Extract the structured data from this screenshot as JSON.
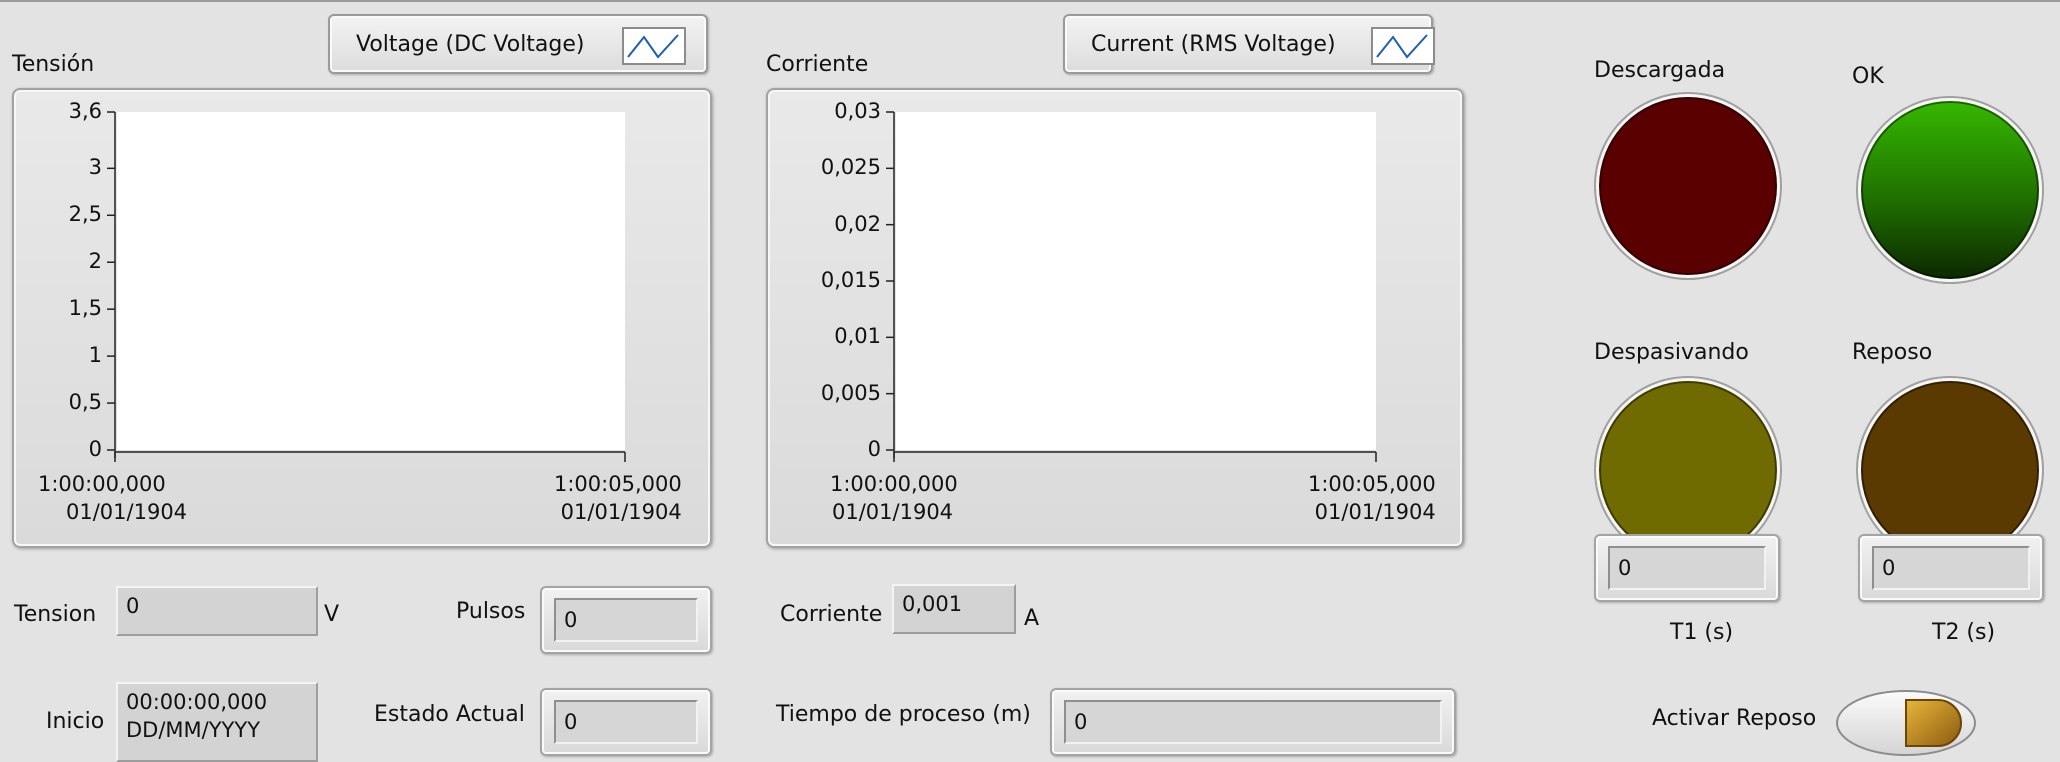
{
  "voltage_graph": {
    "title": "Tensión",
    "legend_label": "Voltage (DC Voltage)",
    "y_ticks": [
      "3,6",
      "3",
      "2,5",
      "2",
      "1,5",
      "1",
      "0,5",
      "0"
    ],
    "x_ticks": [
      {
        "time": "1:00:00,000",
        "date": "01/01/1904"
      },
      {
        "time": "1:00:05,000",
        "date": "01/01/1904"
      }
    ]
  },
  "current_graph": {
    "title": "Corriente",
    "legend_label": "Current (RMS Voltage)",
    "y_ticks": [
      "0,03",
      "0,025",
      "0,02",
      "0,015",
      "0,01",
      "0,005",
      "0"
    ],
    "x_ticks": [
      {
        "time": "1:00:00,000",
        "date": "01/01/1904"
      },
      {
        "time": "1:00:05,000",
        "date": "01/01/1904"
      }
    ]
  },
  "chart_data": [
    {
      "type": "line",
      "title": "Tensión",
      "series": [
        {
          "name": "Voltage (DC Voltage)",
          "values": []
        }
      ],
      "ylim": [
        0,
        3.6
      ],
      "x": [
        "1:00:00,000 01/01/1904",
        "1:00:05,000 01/01/1904"
      ]
    },
    {
      "type": "line",
      "title": "Corriente",
      "series": [
        {
          "name": "Current (RMS Voltage)",
          "values": []
        }
      ],
      "ylim": [
        0,
        0.03
      ],
      "x": [
        "1:00:00,000 01/01/1904",
        "1:00:05,000 01/01/1904"
      ]
    }
  ],
  "indicators": {
    "tension_label": "Tension",
    "tension_value": "0",
    "tension_unit": "V",
    "inicio_label": "Inicio",
    "inicio_time": "00:00:00,000",
    "inicio_date": "DD/MM/YYYY",
    "pulsos_label": "Pulsos",
    "pulsos_value": "0",
    "estado_label": "Estado Actual",
    "estado_value": "0",
    "corriente_label": "Corriente",
    "corriente_value": "0,001",
    "corriente_unit": "A",
    "tiempo_label": "Tiempo de proceso (m)",
    "tiempo_value": "0"
  },
  "leds": {
    "descargada": {
      "label": "Descargada",
      "color": "#5a0000"
    },
    "ok": {
      "label": "OK",
      "color": "#2ea000"
    },
    "despasivando": {
      "label": "Despasivando",
      "color": "#706b00"
    },
    "reposo": {
      "label": "Reposo",
      "color": "#5a3a00"
    }
  },
  "timers": {
    "t1_value": "0",
    "t1_label": "T1 (s)",
    "t2_value": "0",
    "t2_label": "T2 (s)"
  },
  "activar_reposo": {
    "label": "Activar Reposo"
  }
}
